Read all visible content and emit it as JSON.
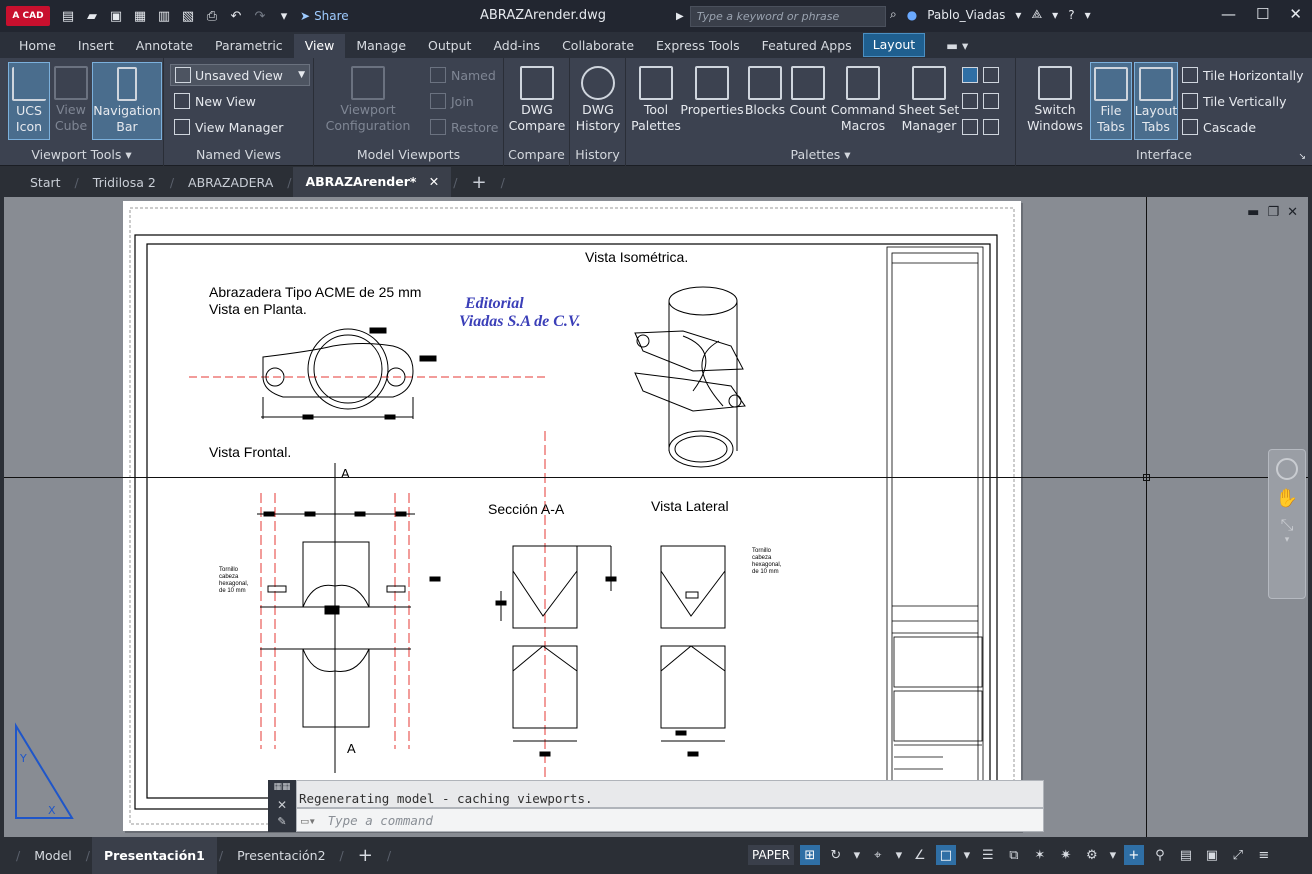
{
  "app": {
    "logo_text": "A CAD",
    "share_label": "Share",
    "doc_title": "ABRAZArender.dwg",
    "search_placeholder": "Type a keyword or phrase",
    "user_name": "Pablo_Viadas",
    "accent": "#2f6fa5"
  },
  "ribbon_tabs": [
    "Home",
    "Insert",
    "Annotate",
    "Parametric",
    "View",
    "Manage",
    "Output",
    "Add-ins",
    "Collaborate",
    "Express Tools",
    "Featured Apps",
    "Layout"
  ],
  "ribbon": {
    "viewport_tools": {
      "title": "Viewport Tools ▾",
      "ucs": "UCS\nIcon",
      "viewcube": "View\nCube",
      "navbar": "Navigation\nBar"
    },
    "named_views": {
      "title": "Named Views",
      "dropdown": "Unsaved View",
      "new_view": "New View",
      "view_manager": "View Manager"
    },
    "model_viewports": {
      "title": "Model Viewports",
      "config": "Viewport\nConfiguration",
      "named": "Named",
      "join": "Join",
      "restore": "Restore"
    },
    "compare": {
      "title": "Compare",
      "btn": "DWG\nCompare"
    },
    "history": {
      "title": "History",
      "btn": "DWG\nHistory"
    },
    "palettes": {
      "title": "Palettes ▾",
      "tool": "Tool\nPalettes",
      "properties": "Properties",
      "blocks": "Blocks",
      "count": "Count",
      "command_macros": "Command\nMacros",
      "sheet_set": "Sheet Set\nManager"
    },
    "interface": {
      "title": "Interface",
      "switch": "Switch\nWindows",
      "file_tabs": "File\nTabs",
      "layout_tabs": "Layout\nTabs",
      "tile_h": "Tile Horizontally",
      "tile_v": "Tile Vertically",
      "cascade": "Cascade"
    }
  },
  "doc_tabs": [
    "Start",
    "Tridilosa 2",
    "ABRAZADERA",
    "ABRAZArender*"
  ],
  "drawing": {
    "title_plant": "Abrazadera Tipo ACME de 25 mm",
    "subtitle_plant": "Vista en Planta.",
    "iso": "Vista Isométrica.",
    "front": "Vista Frontal.",
    "section": "Sección A-A",
    "lateral": "Vista Lateral",
    "section_mark": "A",
    "logo_line1": "Editorial",
    "logo_line2": "Viadas S.A de C.V.",
    "note_left": "Tornillo\ncabeza\nhexagonal,\nde 10 mm",
    "note_right": "Tornillo\ncabeza\nhexagonal,\nde 10 mm"
  },
  "command": {
    "history": "Regenerating model - caching viewports.",
    "placeholder": "Type a command"
  },
  "layout_tabs": [
    "Model",
    "Presentación1",
    "Presentación2"
  ],
  "status": {
    "paper": "PAPER"
  }
}
